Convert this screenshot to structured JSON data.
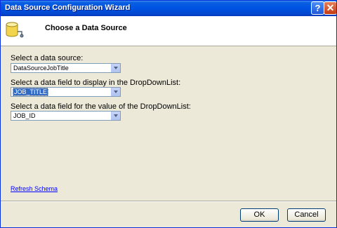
{
  "window": {
    "title": "Data Source Configuration Wizard",
    "help_glyph": "?",
    "close_glyph": "✕"
  },
  "header": {
    "title": "Choose a Data Source",
    "icon": "database-icon"
  },
  "fields": [
    {
      "label": "Select a data source:",
      "value": "DataSourceJobTitle"
    },
    {
      "label": "Select a data field to display in the DropDownList:",
      "value": "JOB_TITLE",
      "selected": true
    },
    {
      "label": "Select a data field for the value of the DropDownList:",
      "value": "JOB_ID"
    }
  ],
  "refresh_link": "Refresh Schema",
  "buttons": {
    "ok": "OK",
    "cancel": "Cancel"
  },
  "colors": {
    "titlebar": "#0054e3",
    "dialog_bg": "#ece9d8",
    "link": "#0000ff",
    "selection": "#316ac5"
  }
}
